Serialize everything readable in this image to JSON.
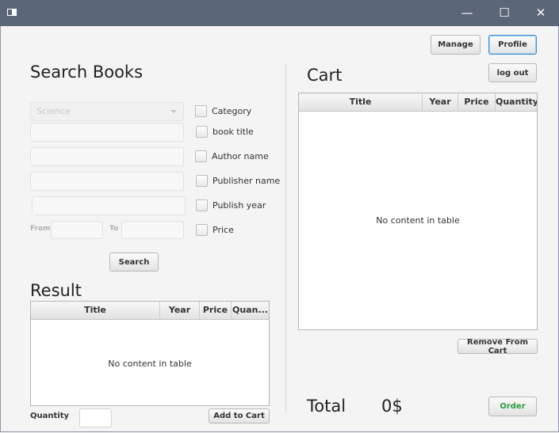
{
  "window": {
    "minimize_glyph": "—",
    "maximize_glyph": "☐",
    "close_glyph": "✕"
  },
  "top_buttons": {
    "manage": "Manage",
    "profile": "Profile",
    "logout": "log out"
  },
  "search": {
    "heading": "Search Books",
    "category_combo": {
      "selected": "Science"
    },
    "filters": [
      "Category",
      "book title",
      "Author name",
      "Publisher name",
      "Publish year",
      "Price"
    ],
    "from_label": "From",
    "to_label": "To",
    "search_button": "Search"
  },
  "result": {
    "heading": "Result",
    "columns": [
      "Title",
      "Year",
      "Price",
      "Quan..."
    ],
    "empty_text": "No content in table",
    "quantity_label": "Quantity",
    "add_to_cart": "Add to Cart"
  },
  "cart": {
    "heading": "Cart",
    "columns": [
      "Title",
      "Year",
      "Price",
      "Quantity"
    ],
    "empty_text": "No content in table",
    "remove_button": "Remove From Cart",
    "total_label": "Total",
    "total_value": "0$",
    "order_button": "Order"
  }
}
